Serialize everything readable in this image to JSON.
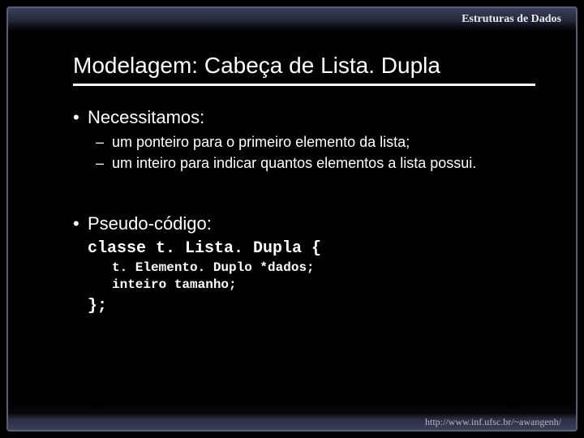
{
  "header": {
    "title": "Estruturas de Dados"
  },
  "footer": {
    "url": "http://www.inf.ufsc.br/~awangenh/"
  },
  "slide": {
    "title": "Modelagem: Cabeça de Lista. Dupla",
    "b1": "Necessitamos:",
    "b1_1": "um ponteiro para o primeiro elemento da lista;",
    "b1_2": "um inteiro para indicar quantos elementos a lista possui.",
    "b2": "Pseudo-código:",
    "code1": "classe t. Lista. Dupla {",
    "code2": "t. Elemento. Duplo *dados;",
    "code3": "inteiro tamanho;",
    "code4": "};"
  }
}
